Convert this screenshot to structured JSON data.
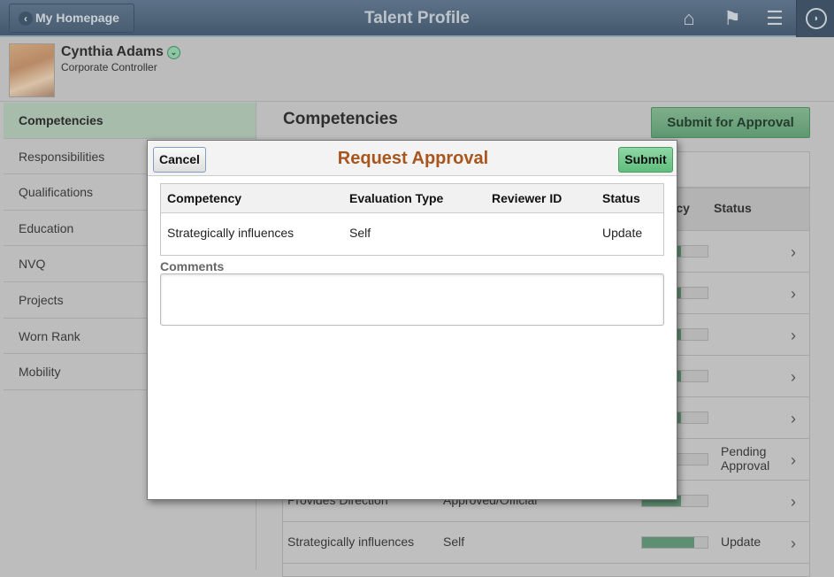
{
  "header": {
    "back_label": "My Homepage",
    "title": "Talent Profile",
    "icons": [
      "home-icon",
      "flag-icon",
      "menu-icon",
      "navbar-compass-icon"
    ]
  },
  "profile": {
    "name": "Cynthia Adams",
    "role": "Corporate Controller"
  },
  "sidebar": {
    "items": [
      {
        "label": "Competencies",
        "selected": true
      },
      {
        "label": "Responsibilities"
      },
      {
        "label": "Qualifications"
      },
      {
        "label": "Education"
      },
      {
        "label": "NVQ"
      },
      {
        "label": "Projects"
      },
      {
        "label": "Worn Rank"
      },
      {
        "label": "Mobility"
      }
    ]
  },
  "main": {
    "title": "Competencies",
    "submit_label": "Submit for Approval",
    "table": {
      "headers": {
        "proficiency": "ency",
        "status": "Status"
      },
      "rows": [
        {
          "competency": "",
          "evaluation": "",
          "proficiency": 0.6,
          "status": ""
        },
        {
          "competency": "",
          "evaluation": "",
          "proficiency": 0.6,
          "status": ""
        },
        {
          "competency": "",
          "evaluation": "",
          "proficiency": 0.6,
          "status": ""
        },
        {
          "competency": "",
          "evaluation": "",
          "proficiency": 0.6,
          "status": ""
        },
        {
          "competency": "",
          "evaluation": "",
          "proficiency": 0.6,
          "status": ""
        },
        {
          "competency": "",
          "evaluation": "",
          "proficiency": 0.5,
          "status": "Pending Approval"
        },
        {
          "competency": "Provides Direction",
          "evaluation": "Approved/Official",
          "proficiency": 0.6,
          "status": ""
        },
        {
          "competency": "Strategically influences",
          "evaluation": "Self",
          "proficiency": 0.8,
          "status": "Update"
        }
      ]
    }
  },
  "modal": {
    "title": "Request Approval",
    "cancel_label": "Cancel",
    "submit_label": "Submit",
    "headers": {
      "competency": "Competency",
      "evaluation": "Evaluation Type",
      "reviewer": "Reviewer ID",
      "status": "Status"
    },
    "row": {
      "competency": "Strategically influences",
      "evaluation": "Self",
      "reviewer": "",
      "status": "Update"
    },
    "comments_label": "Comments",
    "comments_value": ""
  },
  "colors": {
    "modal_title": "#a8561e",
    "submit_green": "#5fbe7d",
    "header_bar": "#4d6278"
  }
}
